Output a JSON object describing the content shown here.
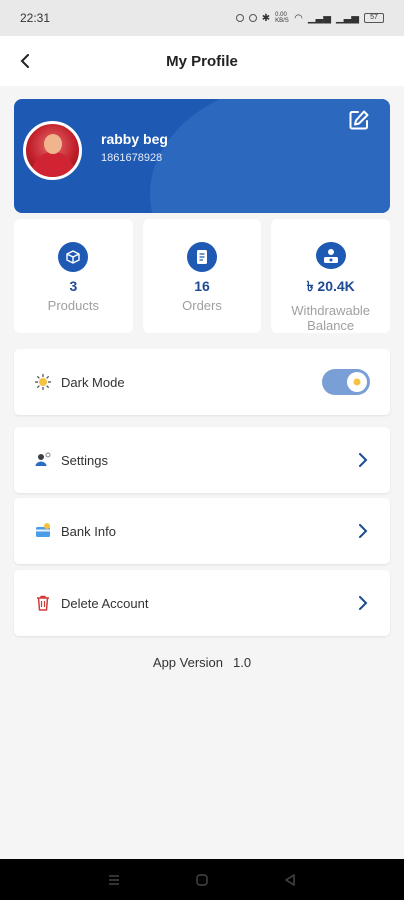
{
  "status_bar": {
    "time": "22:31",
    "signal_text": "0.00 KB/S",
    "battery": "57"
  },
  "app_bar": {
    "title": "My Profile"
  },
  "profile": {
    "name": "rabby beg",
    "phone": "1861678928"
  },
  "stats": [
    {
      "icon": "box-icon",
      "value": "3",
      "label": "Products"
    },
    {
      "icon": "document-icon",
      "value": "16",
      "label": "Orders"
    },
    {
      "icon": "cash-hand-icon",
      "value": "৳ 20.4K",
      "label": "Withdrawable Balance"
    }
  ],
  "menu": {
    "dark_mode": {
      "label": "Dark Mode",
      "enabled": true
    },
    "settings": {
      "label": "Settings"
    },
    "bank_info": {
      "label": "Bank Info"
    },
    "delete_account": {
      "label": "Delete Account"
    }
  },
  "version": {
    "label": "App Version",
    "value": "1.0"
  },
  "colors": {
    "primary": "#1e5ab3",
    "accent": "#1e4a94",
    "delete": "#d23a3a"
  }
}
